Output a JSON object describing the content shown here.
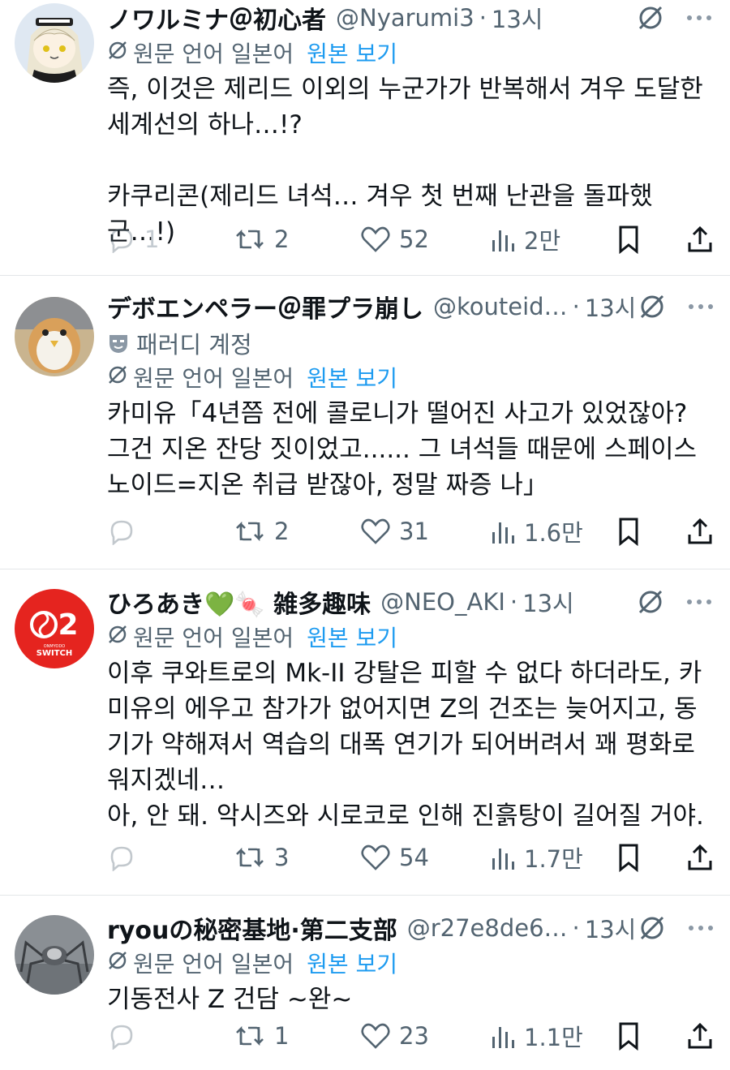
{
  "posts": [
    {
      "name": "ノワルミナ＠初心者",
      "handle": "@Nyarumi3",
      "time": "13시",
      "parody_label": "",
      "translated_from": "원문 언어 일본어",
      "show_original": "원본 보기",
      "text": "즉, 이것은 제리드 이외의 누군가가 반복해서 겨우 도달한 세계선의 하나…!?\n\n카쿠리콘(제리드 녀석… 겨우 첫 번째 난관을 돌파했군…!)",
      "replies": "1",
      "retweets": "2",
      "likes": "52",
      "views": "2만"
    },
    {
      "name": "デボエンペラー＠罪プラ崩し",
      "handle": "@kouteid…",
      "time": "13시",
      "parody_label": "패러디 계정",
      "translated_from": "원문 언어 일본어",
      "show_original": "원본 보기",
      "text": "카미유「4년쯤 전에 콜로니가 떨어진 사고가 있었잖아? 그건 지온 잔당 짓이었고...... 그 녀석들 때문에 스페이스노이드=지온 취급 받잖아, 정말 짜증 나」",
      "replies": "",
      "retweets": "2",
      "likes": "31",
      "views": "1.6만"
    },
    {
      "name": "ひろあき💚🍬 雑多趣味",
      "handle": "@NEO_AKI",
      "time": "13시",
      "parody_label": "",
      "translated_from": "원문 언어 일본어",
      "show_original": "원본 보기",
      "text": "이후 쿠와트로의 Mk-II 강탈은 피할 수 없다 하더라도, 카미유의 에우고 참가가 없어지면 Z의 건조는 늦어지고, 동기가 약해져서 역습의 대폭 연기가 되어버려서 꽤 평화로워지겠네…\n아, 안 돼. 악시즈와 시로코로 인해 진흙탕이 길어질 거야.",
      "replies": "",
      "retweets": "3",
      "likes": "54",
      "views": "1.7만"
    },
    {
      "name": "ryouの秘密基地·第二支部",
      "handle": "@r27e8de6…",
      "time": "13시",
      "parody_label": "",
      "translated_from": "원문 언어 일본어",
      "show_original": "원본 보기",
      "text": "기동전사 Z 건담 ~완~",
      "replies": "",
      "retweets": "1",
      "likes": "23",
      "views": "1.1만"
    }
  ],
  "avatars": [
    {
      "icon": "anime-girl-avatar",
      "bg": "#dfe8f2"
    },
    {
      "icon": "plush-toy-avatar",
      "bg": "#c9b48f"
    },
    {
      "icon": "onmyodo-switch-logo",
      "bg": "#e5241f",
      "logo_text": "2",
      "logo_sub": "SWITCH",
      "logo_tiny": "ONMYODO"
    },
    {
      "icon": "spider-robot-avatar",
      "bg": "#8a8f94"
    }
  ],
  "colors": {
    "link": "#1d9bf0",
    "muted": "#536471",
    "text": "#0f1419",
    "divider": "#e3e6e8"
  }
}
